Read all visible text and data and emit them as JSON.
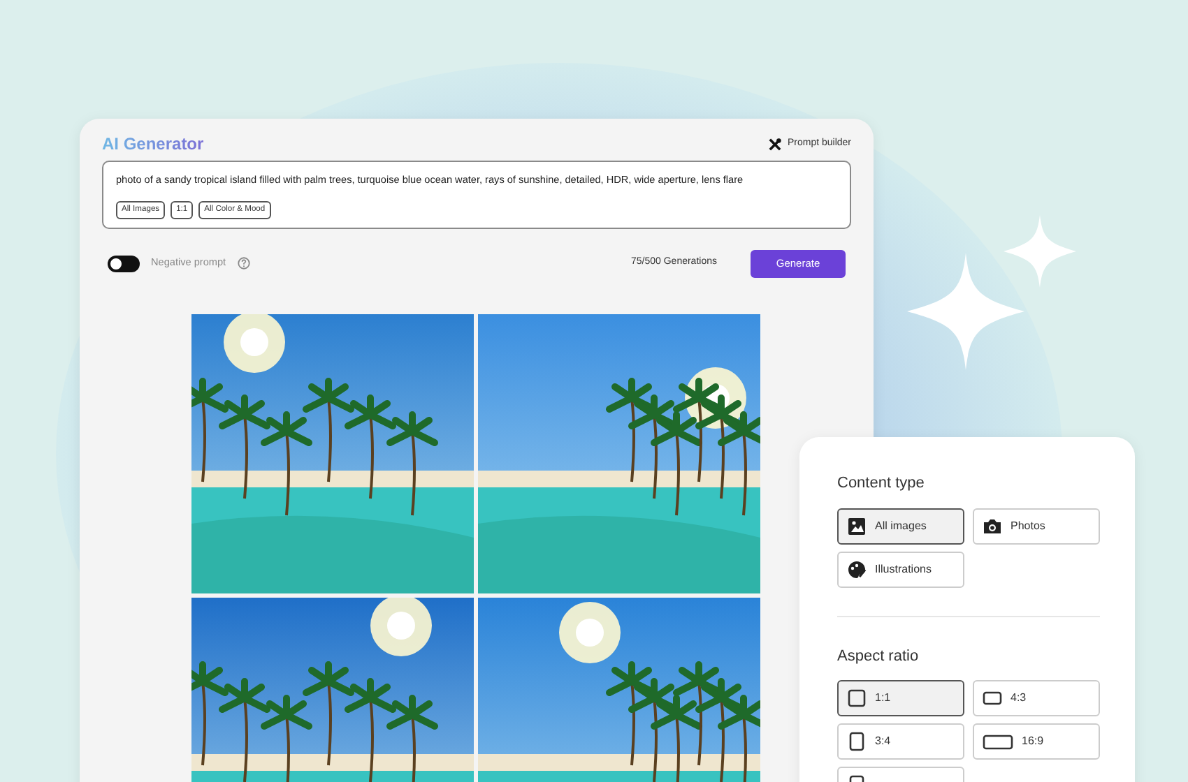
{
  "generator": {
    "title": "AI Generator",
    "prompt_builder": "Prompt builder",
    "prompt": "photo of a sandy tropical island filled with palm trees, turquoise blue ocean water, rays of sunshine, detailed, HDR, wide aperture, lens flare",
    "tags": [
      "All Images",
      "1:1",
      "All Color & Mood"
    ],
    "negative_prompt": {
      "label": "Negative prompt",
      "on": false
    },
    "usage": "75/500 Generations",
    "generate_button": "Generate"
  },
  "filters": {
    "content_type": {
      "title": "Content type",
      "options": [
        {
          "label": "All images",
          "kind": "image",
          "selected": true
        },
        {
          "label": "Photos",
          "kind": "camera",
          "selected": false
        },
        {
          "label": "Illustrations",
          "kind": "palette",
          "selected": false
        }
      ]
    },
    "aspect_ratio": {
      "title": "Aspect ratio",
      "options": [
        {
          "label": "1:1",
          "kind": "square",
          "selected": true
        },
        {
          "label": "4:3",
          "kind": "wide",
          "selected": false
        },
        {
          "label": "3:4",
          "kind": "tall",
          "selected": false
        },
        {
          "label": "16:9",
          "kind": "widest",
          "selected": false
        },
        {
          "kind": "tall",
          "selected": false
        }
      ]
    }
  }
}
